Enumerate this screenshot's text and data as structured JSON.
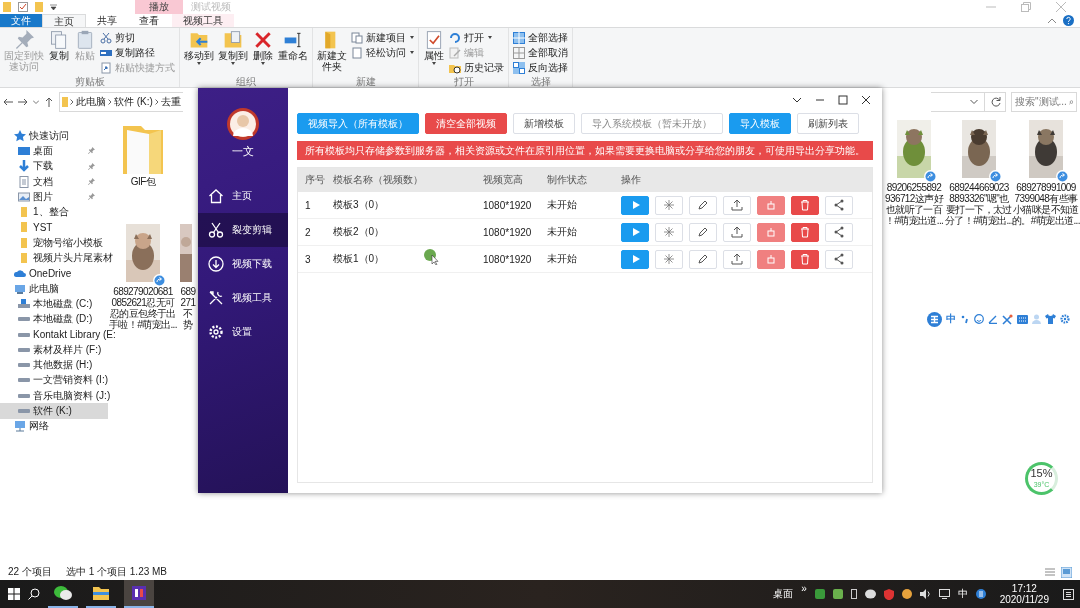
{
  "explorer": {
    "context_tab": "播放",
    "title": "测试视频",
    "ribbon_tabs": [
      {
        "label": "文件",
        "kind": "file",
        "selected": false
      },
      {
        "label": "主页",
        "kind": "tab",
        "selected": true
      },
      {
        "label": "共享",
        "kind": "tab",
        "selected": false
      },
      {
        "label": "查看",
        "kind": "tab",
        "selected": false
      },
      {
        "label": "视频工具",
        "kind": "context",
        "selected": false
      }
    ],
    "ribbon_groups": [
      {
        "label": "剪贴板",
        "items": [
          {
            "label": "固定到快速访问",
            "kind": "large",
            "disabled": true,
            "dropdown": false
          },
          {
            "label": "复制",
            "kind": "large",
            "disabled": false,
            "dropdown": false
          },
          {
            "label": "粘贴",
            "kind": "large",
            "disabled": true,
            "dropdown": false
          },
          {
            "label": "剪切",
            "kind": "small",
            "disabled": false,
            "dropdown": false
          },
          {
            "label": "复制路径",
            "kind": "small",
            "disabled": false,
            "dropdown": false
          },
          {
            "label": "粘贴快捷方式",
            "kind": "small",
            "disabled": true,
            "dropdown": false
          }
        ]
      },
      {
        "label": "组织",
        "items": [
          {
            "label": "移动到",
            "kind": "large",
            "disabled": false,
            "dropdown": true
          },
          {
            "label": "复制到",
            "kind": "large",
            "disabled": false,
            "dropdown": true
          },
          {
            "label": "删除",
            "kind": "large",
            "disabled": false,
            "dropdown": true
          },
          {
            "label": "重命名",
            "kind": "large",
            "disabled": false,
            "dropdown": false
          }
        ]
      },
      {
        "label": "新建",
        "items": [
          {
            "label": "新建文件夹",
            "kind": "large",
            "disabled": false,
            "dropdown": false
          },
          {
            "label": "新建项目",
            "kind": "small",
            "disabled": false,
            "dropdown": true
          },
          {
            "label": "轻松访问",
            "kind": "small",
            "disabled": false,
            "dropdown": true
          }
        ]
      },
      {
        "label": "打开",
        "items": [
          {
            "label": "属性",
            "kind": "large",
            "disabled": false,
            "dropdown": true
          },
          {
            "label": "打开",
            "kind": "small",
            "disabled": false,
            "dropdown": true
          },
          {
            "label": "编辑",
            "kind": "small",
            "disabled": true,
            "dropdown": false
          },
          {
            "label": "历史记录",
            "kind": "small",
            "disabled": false,
            "dropdown": false
          }
        ]
      },
      {
        "label": "选择",
        "items": [
          {
            "label": "全部选择",
            "kind": "small",
            "disabled": false,
            "dropdown": false
          },
          {
            "label": "全部取消",
            "kind": "small",
            "disabled": false,
            "dropdown": false
          },
          {
            "label": "反向选择",
            "kind": "small",
            "disabled": false,
            "dropdown": false
          }
        ]
      }
    ],
    "breadcrumb": [
      "此电脑",
      "软件 (K:)",
      "去重"
    ],
    "search": {
      "placeholder": "搜索\"测试..."
    },
    "nav": [
      {
        "label": "快速访问",
        "kind": "quick",
        "selected": false,
        "children": [
          {
            "label": "桌面",
            "kind": "desktop",
            "pinned": true,
            "selected": false
          },
          {
            "label": "下载",
            "kind": "download",
            "pinned": true,
            "selected": false
          },
          {
            "label": "文档",
            "kind": "document",
            "pinned": true,
            "selected": false
          },
          {
            "label": "图片",
            "kind": "picture",
            "pinned": true,
            "selected": false
          },
          {
            "label": "1、整合",
            "kind": "folder",
            "pinned": false,
            "selected": false
          },
          {
            "label": "YST",
            "kind": "folder",
            "pinned": false,
            "selected": false
          },
          {
            "label": "宠物号缩小模板",
            "kind": "folder",
            "pinned": false,
            "selected": false
          },
          {
            "label": "视频片头片尾素材",
            "kind": "folder",
            "pinned": false,
            "selected": false
          }
        ]
      },
      {
        "label": "OneDrive",
        "kind": "cloud",
        "selected": false
      },
      {
        "label": "此电脑",
        "kind": "pc",
        "selected": false,
        "children": [
          {
            "label": "本地磁盘 (C:)",
            "kind": "system",
            "selected": false
          },
          {
            "label": "本地磁盘 (D:)",
            "kind": "drive",
            "selected": false
          },
          {
            "label": "Kontakt Library (E:",
            "kind": "drive",
            "selected": false
          },
          {
            "label": "素材及样片 (F:)",
            "kind": "drive",
            "selected": false
          },
          {
            "label": "其他数据 (H:)",
            "kind": "drive",
            "selected": false
          },
          {
            "label": "一文营销资料 (I:)",
            "kind": "drive",
            "selected": false
          },
          {
            "label": "音乐电脑资料 (J:)",
            "kind": "drive",
            "selected": false
          },
          {
            "label": "软件 (K:)",
            "kind": "drive",
            "selected": true
          }
        ]
      },
      {
        "label": "网络",
        "kind": "network",
        "selected": false
      }
    ],
    "files": [
      {
        "kind": "folder",
        "lines": [
          "GIF包"
        ]
      },
      {
        "kind": "video",
        "lines": [
          "689279020681",
          "0852621忍无可",
          "忍的豆包终于出",
          "手啦！#萌宠出..."
        ]
      },
      {
        "kind": "partial",
        "lines": [
          "689",
          "271",
          "不",
          "势"
        ]
      },
      {
        "kind": "video",
        "lines": [
          "89206255892",
          "936712这声好",
          "也就听了一百",
          "！#萌宠出道..."
        ]
      },
      {
        "kind": "video",
        "lines": [
          "689244669023",
          "8893326\"嗯\"也",
          "要打一下，太过",
          "分了！#萌宠出..."
        ]
      },
      {
        "kind": "video",
        "lines": [
          "689278991009",
          "7399048有些事",
          "小猫咪是不知道",
          "的。#萌宠出道..."
        ]
      }
    ],
    "status": {
      "count": "22 个项目",
      "selection": "选中 1 个项目  1.23 MB"
    }
  },
  "app": {
    "user": "一文",
    "nav": [
      {
        "label": "主页",
        "selected": false
      },
      {
        "label": "裂变剪辑",
        "selected": true
      },
      {
        "label": "视频下载",
        "selected": false
      },
      {
        "label": "视频工具",
        "selected": false
      },
      {
        "label": "设置",
        "selected": false
      }
    ],
    "toolbar": [
      {
        "label": "视频导入（所有模板）",
        "kind": "primary"
      },
      {
        "label": "清空全部视频",
        "kind": "danger"
      },
      {
        "label": "新增模板",
        "kind": "plain"
      },
      {
        "label": "导入系统模板（暂未开放）",
        "kind": "disabled"
      },
      {
        "label": "导入模板",
        "kind": "primary"
      },
      {
        "label": "刷新列表",
        "kind": "plain"
      }
    ],
    "notice": "所有模板均只存储参数到服务器，相关资源或文件在原引用位置，如果需要更换电脑或分享给您的朋友，可使用导出分享功能。",
    "table": {
      "columns": [
        "序号",
        "模板名称（视频数）",
        "视频宽高",
        "制作状态",
        "操作"
      ],
      "rows": [
        {
          "index": "1",
          "name": "模板3（0）",
          "size": "1080*1920",
          "status": "未开始"
        },
        {
          "index": "2",
          "name": "模板2（0）",
          "size": "1080*1920",
          "status": "未开始"
        },
        {
          "index": "3",
          "name": "模板1（0）",
          "size": "1080*1920",
          "status": "未开始"
        }
      ]
    }
  },
  "ime_bar": {
    "mode": "中"
  },
  "monitor": {
    "percent": "15%",
    "temp": "39°C"
  },
  "taskbar": {
    "desktop": "桌面",
    "overflow": "»",
    "ime": "中",
    "time": "17:12",
    "date": "2020/11/29"
  }
}
